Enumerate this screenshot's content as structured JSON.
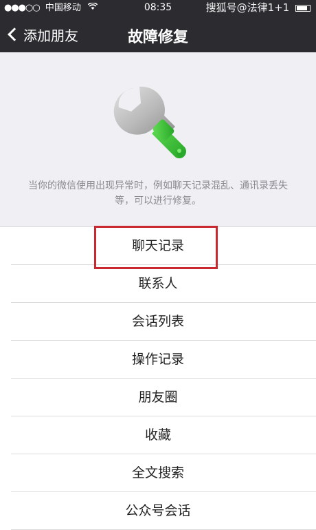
{
  "status_bar": {
    "signal": "●●●○○",
    "carrier": "中国移动",
    "time": "08:35",
    "watermark": "搜狐号@法律1+1"
  },
  "nav": {
    "back_label": "添加朋友",
    "title": "故障修复"
  },
  "hero": {
    "description": "当你的微信使用出现异常时，例如聊天记录混乱、通讯录丢失等，可以进行修复。"
  },
  "options": [
    {
      "label": "聊天记录"
    },
    {
      "label": "联系人"
    },
    {
      "label": "会话列表"
    },
    {
      "label": "操作记录"
    },
    {
      "label": "朋友圈"
    },
    {
      "label": "收藏"
    },
    {
      "label": "全文搜索"
    },
    {
      "label": "公众号会话"
    }
  ],
  "colors": {
    "nav_bg": "#2b2b30",
    "hero_bg": "#efeff4",
    "wrench_handle": "#3dbf3a",
    "highlight_border": "#c8282e"
  }
}
